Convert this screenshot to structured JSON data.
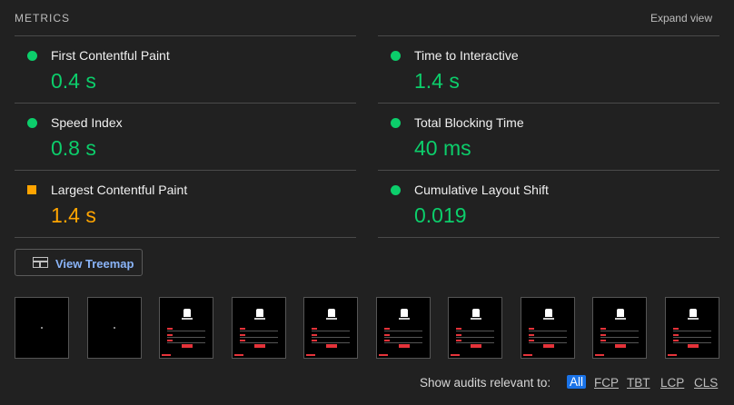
{
  "header": {
    "title": "METRICS",
    "expand_label": "Expand view"
  },
  "metrics": {
    "fcp": {
      "label": "First Contentful Paint",
      "value": "0.4 s",
      "status": "good"
    },
    "tti": {
      "label": "Time to Interactive",
      "value": "1.4 s",
      "status": "good"
    },
    "si": {
      "label": "Speed Index",
      "value": "0.8 s",
      "status": "good"
    },
    "tbt": {
      "label": "Total Blocking Time",
      "value": "40 ms",
      "status": "good"
    },
    "lcp": {
      "label": "Largest Contentful Paint",
      "value": "1.4 s",
      "status": "average"
    },
    "cls": {
      "label": "Cumulative Layout Shift",
      "value": "0.019",
      "status": "good"
    }
  },
  "colors": {
    "good": "#0cce6b",
    "average": "#ffa400",
    "accent": "#1a73e8",
    "background": "#212121"
  },
  "treemap": {
    "label": "View Treemap",
    "icon": "treemap-icon"
  },
  "filmstrip": {
    "frame_count": 10
  },
  "filter": {
    "label": "Show audits relevant to:",
    "options": [
      "All",
      "FCP",
      "TBT",
      "LCP",
      "CLS"
    ],
    "selected": "All"
  }
}
